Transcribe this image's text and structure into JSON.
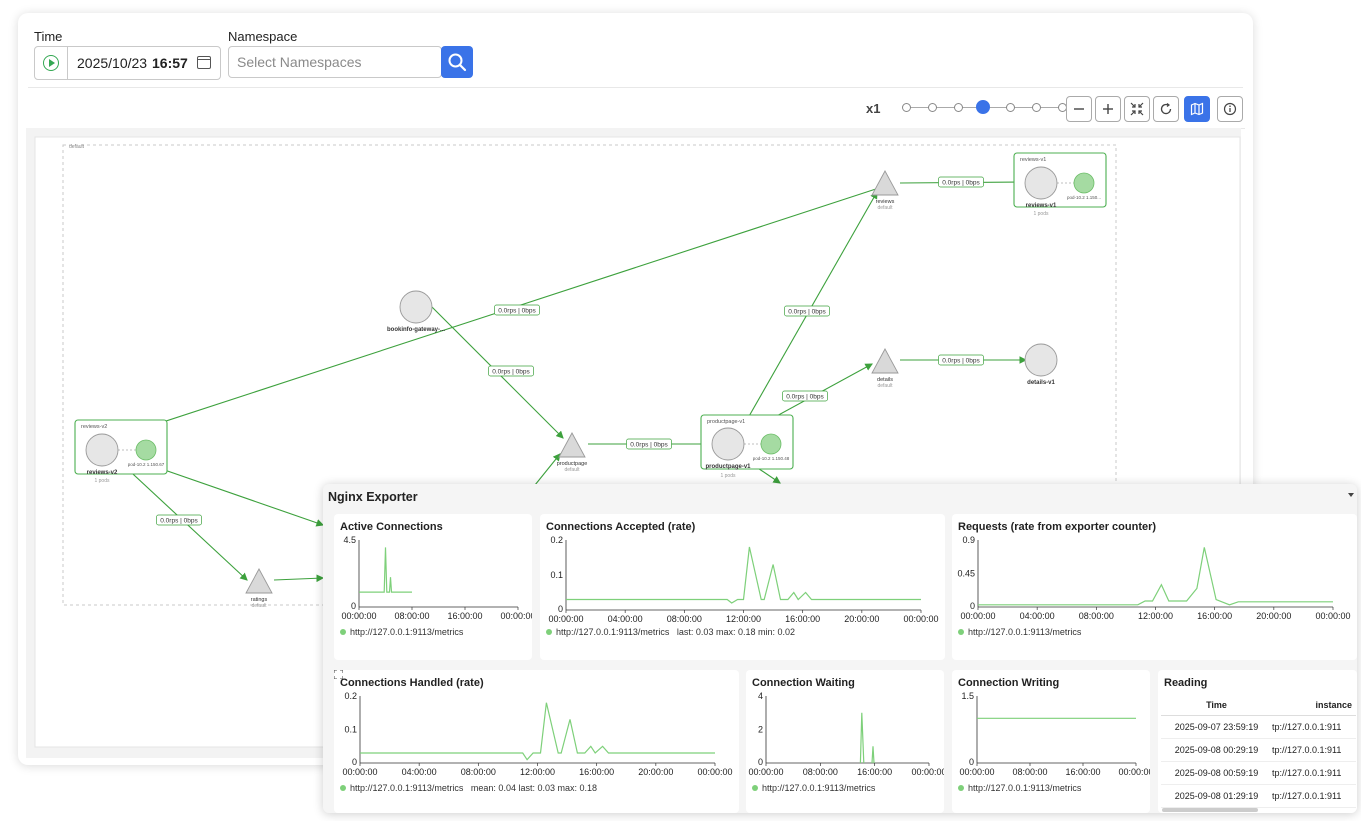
{
  "toolbar": {
    "time_label": "Time",
    "date": "2025/10/23",
    "time": "16:57",
    "namespace_label": "Namespace",
    "namespace_placeholder": "Select Namespaces",
    "zoom_speed": "x1",
    "slider_level": 4,
    "slider_steps": 7
  },
  "graph": {
    "group_label": "default",
    "edge_label": "0.0rps | 0bps",
    "nodes": [
      {
        "name": "reviews-v2",
        "type": "workload",
        "box_label": "reviews-v2",
        "sub": "1 pods",
        "pod": "pod-10.2 1.150.67"
      },
      {
        "name": "bookinfo-gateway-...",
        "type": "workload"
      },
      {
        "name": "productpage",
        "type": "service",
        "sub": "default"
      },
      {
        "name": "productpage-v1",
        "type": "workload",
        "box_label": "productpage-v1",
        "sub": "1 pods",
        "pod": "pod-10.2 1.150.48"
      },
      {
        "name": "reviews",
        "type": "service",
        "sub": "default"
      },
      {
        "name": "reviews-v1",
        "type": "workload",
        "box_label": "reviews-v1",
        "sub": "1 pods",
        "pod": "pod-10.2 1.150..."
      },
      {
        "name": "details",
        "type": "service",
        "sub": "default"
      },
      {
        "name": "details-v1",
        "type": "workload"
      },
      {
        "name": "ratings",
        "type": "service",
        "sub": "default"
      }
    ]
  },
  "panel": {
    "title": "Nginx Exporter",
    "cards": {
      "active": {
        "title": "Active Connections",
        "legend": "http://127.0.0.1:9113/metrics",
        "chart_data": {
          "type": "line",
          "title": "Active Connections",
          "ylim": [
            0,
            4.5
          ],
          "y_ticks": [
            "4.5",
            "0"
          ],
          "x_ticks": [
            "00:00:00",
            "08:00:00",
            "16:00:00",
            "00:00:00"
          ],
          "series": [
            {
              "name": "http://127.0.0.1:9113/metrics",
              "color": "#7ed07a",
              "x": [
                0,
                3.8,
                4.0,
                4.2,
                4.6,
                4.75,
                4.9,
                8.0
              ],
              "values": [
                1,
                1,
                4,
                1,
                1,
                2,
                1,
                1
              ]
            }
          ]
        }
      },
      "accepted": {
        "title": "Connections Accepted (rate)",
        "legend": "http://127.0.0.1:9113/metrics",
        "stats": "last: 0.03  max: 0.18  min: 0.02",
        "chart_data": {
          "type": "line",
          "title": "Connections Accepted (rate)",
          "ylim": [
            0,
            0.2
          ],
          "y_ticks": [
            "0.2",
            "0.1",
            "0"
          ],
          "x_ticks": [
            "00:00:00",
            "04:00:00",
            "08:00:00",
            "12:00:00",
            "16:00:00",
            "20:00:00",
            "00:00:00"
          ],
          "series": [
            {
              "name": "http://127.0.0.1:9113/metrics",
              "color": "#7ed07a",
              "x": [
                0,
                10.9,
                11.2,
                11.6,
                12.0,
                12.4,
                13.2,
                13.4,
                14.0,
                14.5,
                15.0,
                15.4,
                15.7,
                16.2,
                16.6,
                17.0,
                24
              ],
              "values": [
                0.03,
                0.03,
                0.02,
                0.03,
                0.03,
                0.18,
                0.03,
                0.03,
                0.13,
                0.03,
                0.03,
                0.05,
                0.03,
                0.05,
                0.03,
                0.03,
                0.03
              ]
            }
          ]
        }
      },
      "requests": {
        "title": "Requests (rate from exporter counter)",
        "legend": "http://127.0.0.1:9113/metrics",
        "chart_data": {
          "type": "line",
          "title": "Requests (rate from exporter counter)",
          "ylim": [
            0,
            0.9
          ],
          "y_ticks": [
            "0.9",
            "0.45",
            "0"
          ],
          "x_ticks": [
            "00:00:00",
            "04:00:00",
            "08:00:00",
            "12:00:00",
            "16:00:00",
            "20:00:00",
            "00:00:00"
          ],
          "series": [
            {
              "name": "http://127.0.0.1:9113/metrics",
              "color": "#7ed07a",
              "x": [
                0,
                10.8,
                11.3,
                11.8,
                12.4,
                12.9,
                14.1,
                14.8,
                15.3,
                16.1,
                17.0,
                17.6,
                18.0,
                24
              ],
              "values": [
                0.03,
                0.03,
                0.08,
                0.08,
                0.3,
                0.08,
                0.08,
                0.25,
                0.8,
                0.1,
                0.03,
                0.07,
                0.07,
                0.07
              ]
            }
          ]
        }
      },
      "handled": {
        "title": "Connections Handled (rate)",
        "legend": "http://127.0.0.1:9113/metrics",
        "stats": "mean: 0.04  last: 0.03  max: 0.18",
        "chart_data": {
          "type": "line",
          "title": "Connections Handled (rate)",
          "ylim": [
            0,
            0.2
          ],
          "y_ticks": [
            "0.2",
            "0.1",
            "0"
          ],
          "x_ticks": [
            "00:00:00",
            "04:00:00",
            "08:00:00",
            "12:00:00",
            "16:00:00",
            "20:00:00",
            "00:00:00"
          ],
          "series": [
            {
              "name": "http://127.0.0.1:9113/metrics",
              "color": "#7ed07a",
              "x": [
                0,
                11.0,
                11.3,
                11.7,
                12.2,
                12.6,
                13.4,
                13.6,
                14.2,
                14.7,
                15.2,
                15.6,
                15.9,
                16.4,
                16.8,
                17.2,
                24
              ],
              "values": [
                0.03,
                0.03,
                0.01,
                0.03,
                0.03,
                0.18,
                0.03,
                0.03,
                0.13,
                0.03,
                0.03,
                0.05,
                0.03,
                0.05,
                0.03,
                0.03,
                0.03
              ]
            }
          ]
        }
      },
      "waiting": {
        "title": "Connection Waiting",
        "legend": "http://127.0.0.1:9113/metrics",
        "chart_data": {
          "type": "line",
          "title": "Connection Waiting",
          "ylim": [
            0,
            4
          ],
          "y_ticks": [
            "4",
            "2",
            "0"
          ],
          "x_ticks": [
            "00:00:00",
            "08:00:00",
            "16:00:00",
            "00:00:00"
          ],
          "series": [
            {
              "name": "http://127.0.0.1:9113/metrics",
              "color": "#7ed07a",
              "x": [
                13.9,
                14.1,
                14.4
              ],
              "values": [
                0,
                3,
                0
              ]
            },
            {
              "name": "http://127.0.0.1:9113/metrics",
              "color": "#7ed07a",
              "x": [
                15.6,
                15.75,
                15.9
              ],
              "values": [
                0,
                1,
                0
              ]
            }
          ]
        }
      },
      "writing": {
        "title": "Connection Writing",
        "legend": "http://127.0.0.1:9113/metrics",
        "chart_data": {
          "type": "line",
          "title": "Connection Writing",
          "ylim": [
            0,
            1.5
          ],
          "y_ticks": [
            "1.5",
            "0"
          ],
          "x_ticks": [
            "00:00:00",
            "08:00:00",
            "16:00:00",
            "00:00:00"
          ],
          "series": [
            {
              "name": "http://127.0.0.1:9113/metrics",
              "color": "#7ed07a",
              "x": [
                0,
                24
              ],
              "values": [
                1,
                1
              ]
            }
          ]
        }
      },
      "reading": {
        "title": "Reading",
        "columns": [
          "Time",
          "instance"
        ],
        "rows": [
          [
            "2025-09-07 23:59:19",
            "tp://127.0.0.1:911"
          ],
          [
            "2025-09-08 00:29:19",
            "tp://127.0.0.1:911"
          ],
          [
            "2025-09-08 00:59:19",
            "tp://127.0.0.1:911"
          ],
          [
            "2025-09-08 01:29:19",
            "tp://127.0.0.1:911"
          ]
        ]
      }
    }
  },
  "colors": {
    "accent": "#3a73e8",
    "edge": "#3da13d",
    "series": "#7ed07a",
    "box": "#4caf50"
  }
}
